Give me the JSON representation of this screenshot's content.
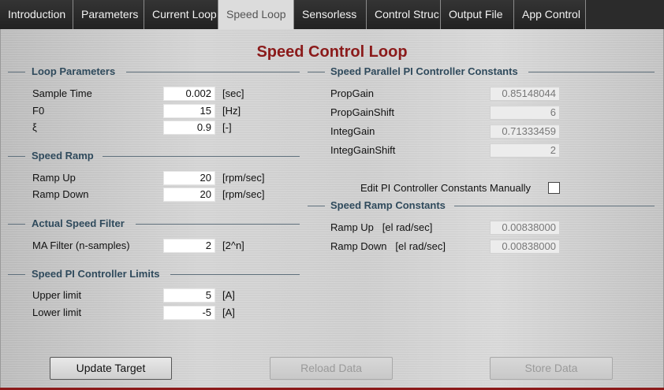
{
  "tabs": [
    {
      "label": "Introduction"
    },
    {
      "label": "Parameters"
    },
    {
      "label": "Current Loop"
    },
    {
      "label": "Speed Loop"
    },
    {
      "label": "Sensorless"
    },
    {
      "label": "Control Struc"
    },
    {
      "label": "Output File"
    },
    {
      "label": "App Control"
    }
  ],
  "active_tab": "Speed Loop",
  "page_title": "Speed Control Loop",
  "loop_parameters": {
    "title": "Loop Parameters",
    "sample_time": {
      "label": "Sample Time",
      "value": "0.002",
      "unit": "[sec]"
    },
    "f0": {
      "label": "F0",
      "value": "15",
      "unit": "[Hz]"
    },
    "xi": {
      "label": "ξ",
      "value": "0.9",
      "unit": "[-]"
    }
  },
  "speed_ramp": {
    "title": "Speed Ramp",
    "ramp_up": {
      "label": "Ramp Up",
      "value": "20",
      "unit": "[rpm/sec]"
    },
    "ramp_down": {
      "label": "Ramp Down",
      "value": "20",
      "unit": "[rpm/sec]"
    }
  },
  "actual_speed_filter": {
    "title": "Actual Speed Filter",
    "ma_filter": {
      "label": "MA Filter (n-samples)",
      "value": "2",
      "unit": "[2^n]"
    }
  },
  "pi_limits": {
    "title": "Speed PI Controller Limits",
    "upper": {
      "label": "Upper limit",
      "value": "5",
      "unit": "[A]"
    },
    "lower": {
      "label": "Lower limit",
      "value": "-5",
      "unit": "[A]"
    }
  },
  "pi_constants": {
    "title": "Speed Parallel PI Controller Constants",
    "prop_gain": {
      "label": "PropGain",
      "value": "0.85148044"
    },
    "prop_gain_shift": {
      "label": "PropGainShift",
      "value": "6"
    },
    "integ_gain": {
      "label": "IntegGain",
      "value": "0.71333459"
    },
    "integ_gain_shift": {
      "label": "IntegGainShift",
      "value": "2"
    },
    "edit_manually": {
      "label": "Edit PI Controller Constants Manually",
      "checked": false
    }
  },
  "ramp_constants": {
    "title": "Speed Ramp Constants",
    "ramp_up": {
      "label": "Ramp Up   [el rad/sec]",
      "value": "0.00838000"
    },
    "ramp_down": {
      "label": "Ramp Down   [el rad/sec]",
      "value": "0.00838000"
    }
  },
  "buttons": {
    "update_target": "Update Target",
    "reload_data": "Reload Data",
    "store_data": "Store Data"
  }
}
